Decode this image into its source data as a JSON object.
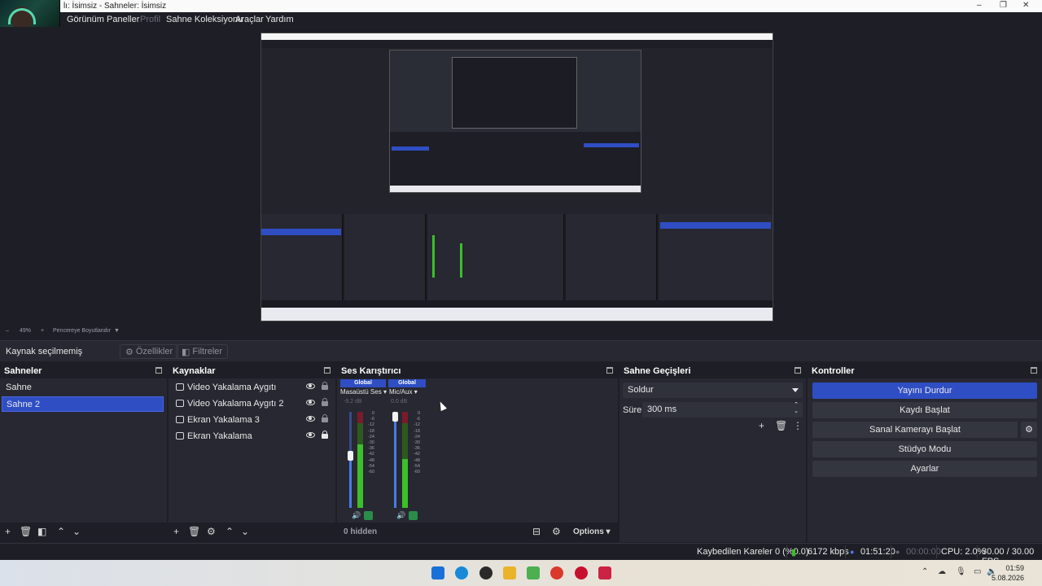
{
  "window": {
    "title": "lı: İsimsiz - Sahneler: İsimsiz",
    "minimize": "–",
    "maximize": "❐",
    "close": "✕"
  },
  "menu": {
    "items": [
      "Görünüm",
      "Paneller",
      "Profil",
      "Sahne Koleksiyonu",
      "Araçlar",
      "Yardım"
    ]
  },
  "preview_toolbar": {
    "zoom": "49%",
    "mode": "Pencereye Boyutlandır"
  },
  "source_toolbar": {
    "no_source": "Kaynak seçilmemiş",
    "properties": "Özellikler",
    "filters": "Filtreler"
  },
  "scenes": {
    "title": "Sahneler",
    "items": [
      "Sahne",
      "Sahne 2"
    ],
    "selected_index": 1
  },
  "sources": {
    "title": "Kaynaklar",
    "items": [
      {
        "label": "Video Yakalama Aygıtı",
        "icon": "camera-icon",
        "locked": false
      },
      {
        "label": "Video Yakalama Aygıtı 2",
        "icon": "camera-icon",
        "locked": false
      },
      {
        "label": "Ekran Yakalama 3",
        "icon": "monitor-icon",
        "locked": false
      },
      {
        "label": "Ekran Yakalama",
        "icon": "monitor-icon",
        "locked": true
      }
    ]
  },
  "mixer": {
    "title": "Ses Karıştırıcı",
    "channels": [
      {
        "header": "Global",
        "name": "Masaüstü Ses",
        "db": "-9.2 dB",
        "volume": 0.55
      },
      {
        "header": "Global",
        "name": "Mic/Aux",
        "db": "0.0 dB",
        "volume": 1.0
      }
    ],
    "scale": [
      "0",
      "-6",
      "-12",
      "-18",
      "-24",
      "-30",
      "-36",
      "-42",
      "-48",
      "-54",
      "-60"
    ],
    "hidden": "0 hidden",
    "options": "Options"
  },
  "transitions": {
    "title": "Sahne Geçişleri",
    "type": "Soldur",
    "duration_label": "Süre",
    "duration_value": "300 ms"
  },
  "controls": {
    "title": "Kontroller",
    "buttons": [
      "Yayını Durdur",
      "Kaydı Başlat",
      "Sanal Kamerayı Başlat",
      "Stüdyo Modu",
      "Ayarlar"
    ]
  },
  "status": {
    "dropped": "Kaybedilen Kareler 0 (%0.0)",
    "bitrate": "6172 kbps",
    "stream_time": "01:51:20",
    "rec_time": "00:00:00",
    "cpu": "CPU: 2.0%",
    "fps": "30.00 / 30.00 FPS"
  },
  "taskbar": {
    "time": "01:59",
    "date": "5.08.2026"
  },
  "colors": {
    "accent": "#2f4ec4",
    "panel": "#272831",
    "background": "#1e1f26"
  }
}
